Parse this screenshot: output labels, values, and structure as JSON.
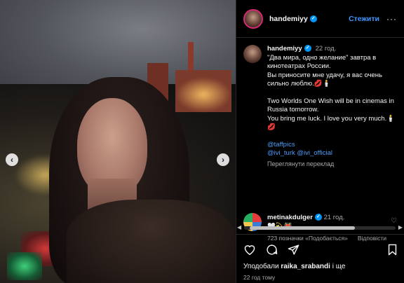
{
  "post": {
    "username": "handemiyy",
    "follow_label": "Стежити",
    "more_label": "···",
    "caption": {
      "time": "22 год.",
      "ru_line1": "\"Два мира, одно желание\" завтра в кинотеатрах России.",
      "ru_line2": "Вы приносите мне удачу, я вас очень сильно люблю.💋🕯️",
      "en_line1": "Two Worlds One Wish will be in cinemas in Russia tomorrow.",
      "en_line2": "You bring me luck. I love you very much.🕯️💋",
      "tag1": "@taffpics",
      "tag2": "@ivi_turk @ivi_official",
      "translate": "Переглянути переклад"
    },
    "comment": {
      "username": "metinakdulger",
      "time": "21 год.",
      "text": "🤍💫👹",
      "likes": "723 позначки «Подобається»",
      "reply": "Відповісти"
    },
    "likes_text_prefix": "Уподобали ",
    "likes_user": "raika_srabandi",
    "likes_text_suffix": " і ще",
    "ago": "22 год тому"
  },
  "nav": {
    "prev": "‹",
    "next": "›"
  },
  "colors": {
    "accent": "#0095f6",
    "link": "#4f9cf9",
    "muted": "#a8a8a8"
  }
}
